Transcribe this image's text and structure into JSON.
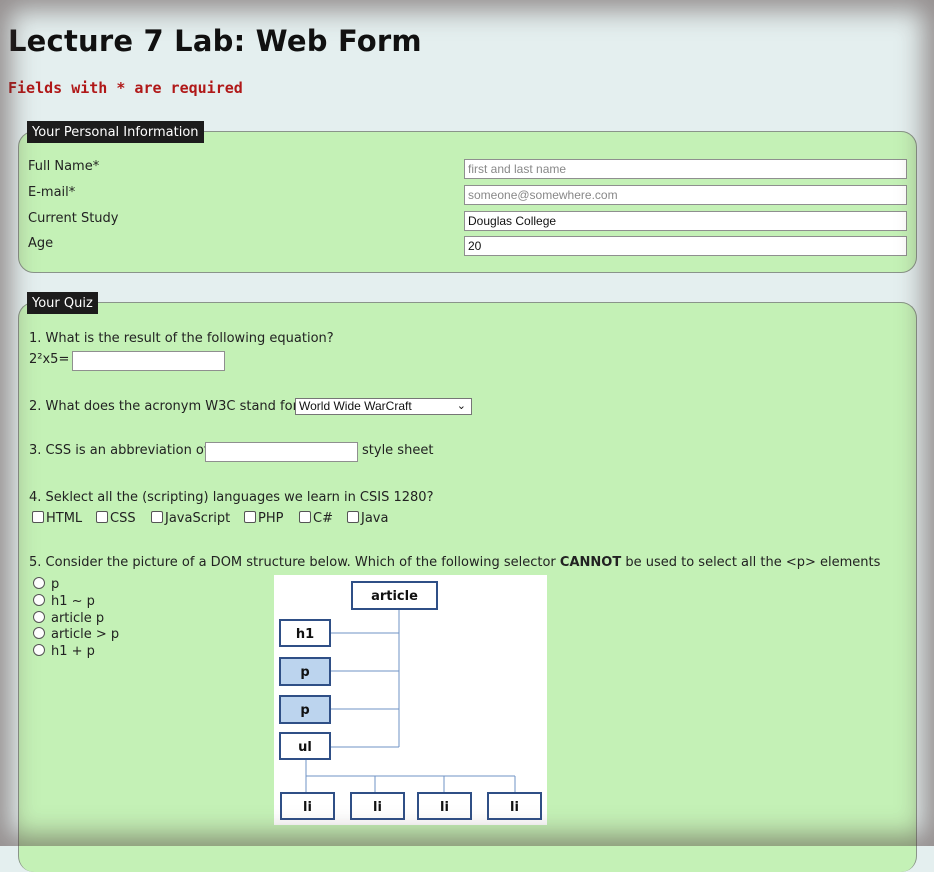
{
  "page": {
    "title": "Lecture 7 Lab: Web Form",
    "required_note": "Fields with * are required"
  },
  "personal": {
    "legend": "Your Personal Information",
    "fields": [
      {
        "label": "Full Name*",
        "value": "",
        "placeholder": "first and last name"
      },
      {
        "label": "E-mail*",
        "value": "",
        "placeholder": "someone@somewhere.com"
      },
      {
        "label": "Current Study",
        "value": "Douglas College",
        "placeholder": ""
      },
      {
        "label": "Age",
        "value": "20",
        "placeholder": ""
      }
    ]
  },
  "quiz": {
    "legend": "Your Quiz",
    "q1": {
      "text": "1. What is the result of the following equation?",
      "equation": "2²x5=",
      "value": ""
    },
    "q2": {
      "text": "2. What does the acronym W3C stand for?",
      "selected": "World Wide WarCraft"
    },
    "q3": {
      "before": "3. CSS is an abbreviation of",
      "after": "style sheet",
      "value": ""
    },
    "q4": {
      "text": "4. Seklect all the (scripting) languages we learn in CSIS 1280?",
      "options": [
        "HTML",
        "CSS",
        "JavaScript",
        "PHP",
        "C#",
        "Java"
      ]
    },
    "q5": {
      "text_before": "5. Consider the picture of a DOM structure below. Which of the following selector",
      "text_bold": "CANNOT",
      "text_after": "be used to select all the <p> elements",
      "options": [
        "p",
        "h1 ~ p",
        "article p",
        "article > p",
        "h1 + p"
      ]
    },
    "dom_image": {
      "root": "article",
      "children": [
        "h1",
        "p",
        "p",
        "ul"
      ],
      "grandchildren": [
        "li",
        "li",
        "li",
        "li"
      ],
      "highlight_color": "#bcd4ee",
      "border_color": "#2f4f86",
      "line_color": "#6f93c6"
    }
  },
  "colors": {
    "fieldset_bg": "#c4f1b6",
    "legend_bg": "#1c1c1c",
    "required_text": "#b01818",
    "page_bg": "#e4efef"
  }
}
